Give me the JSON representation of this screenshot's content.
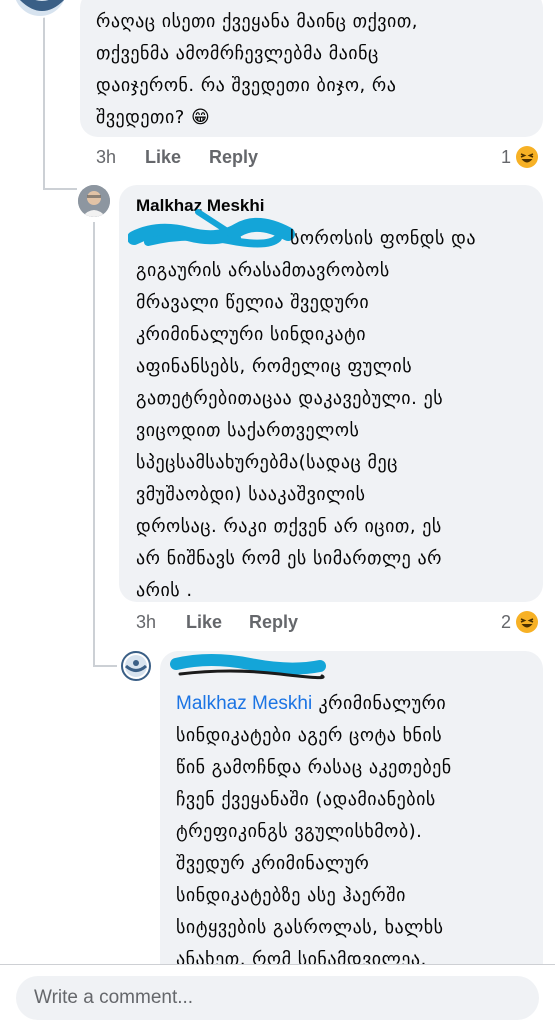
{
  "comments": [
    {
      "id": "c1",
      "author": "",
      "body_lines": [
        "რაღაც ისეთი ქვეყანა მაინც თქვით,",
        "თქვენმა ამომრჩევლებმა მაინც",
        "დაიჯერონ. რა შვედეთი ბიჯო, რა",
        "შვედეთი? 😁"
      ],
      "time": "3h",
      "like_label": "Like",
      "reply_label": "Reply",
      "reaction_count": "1",
      "reaction_icon": "laugh-emoji-icon"
    },
    {
      "id": "c2",
      "author": "Malkhaz Meskhi",
      "first_line_tail": "სოროსის ფონდს და",
      "body_lines": [
        "გიგაურის არასამთავრობოს",
        "მრავალი წელია შვედური",
        "კრიმინალური სინდიკატი",
        "აფინანსებს, რომელიც ფულის",
        "გათეტრებითაცაა დაკავებული. ეს",
        "ვიცოდით საქართველოს",
        "სპეცსამსახურებმა(სადაც მეც",
        "ვმუშაობდი) სააკაშვილის",
        "დროსაც. რაკი თქვენ არ იცით, ეს",
        "არ ნიშნავს რომ ეს სიმართლე არ",
        "არის ."
      ],
      "time": "3h",
      "like_label": "Like",
      "reply_label": "Reply",
      "reaction_count": "2",
      "reaction_icon": "laugh-emoji-icon"
    },
    {
      "id": "c3",
      "author": "",
      "mention": "Malkhaz Meskhi",
      "first_line_tail": "კრიმინალური",
      "body_lines": [
        "სინდიკატები აგერ ცოტა ხნის",
        "წინ გამოჩნდა რასაც აკეთებენ",
        "ჩვენ ქვეყანაში (ადამიანების",
        "ტრეფიკინგს ვგულისხმობ).",
        "შვედურ კრიმინალურ",
        "სინდიკატებზე ასე ჰაერში",
        "სიტყვების გასროლას, ხალხს",
        "ანახეთ, რომ სინამდვილეა."
      ]
    }
  ],
  "composer": {
    "placeholder": "Write a comment..."
  },
  "colors": {
    "bubble": "#f0f2f5",
    "meta": "#65676b",
    "mention": "#1b74e4",
    "redaction": "#14a5d8"
  }
}
